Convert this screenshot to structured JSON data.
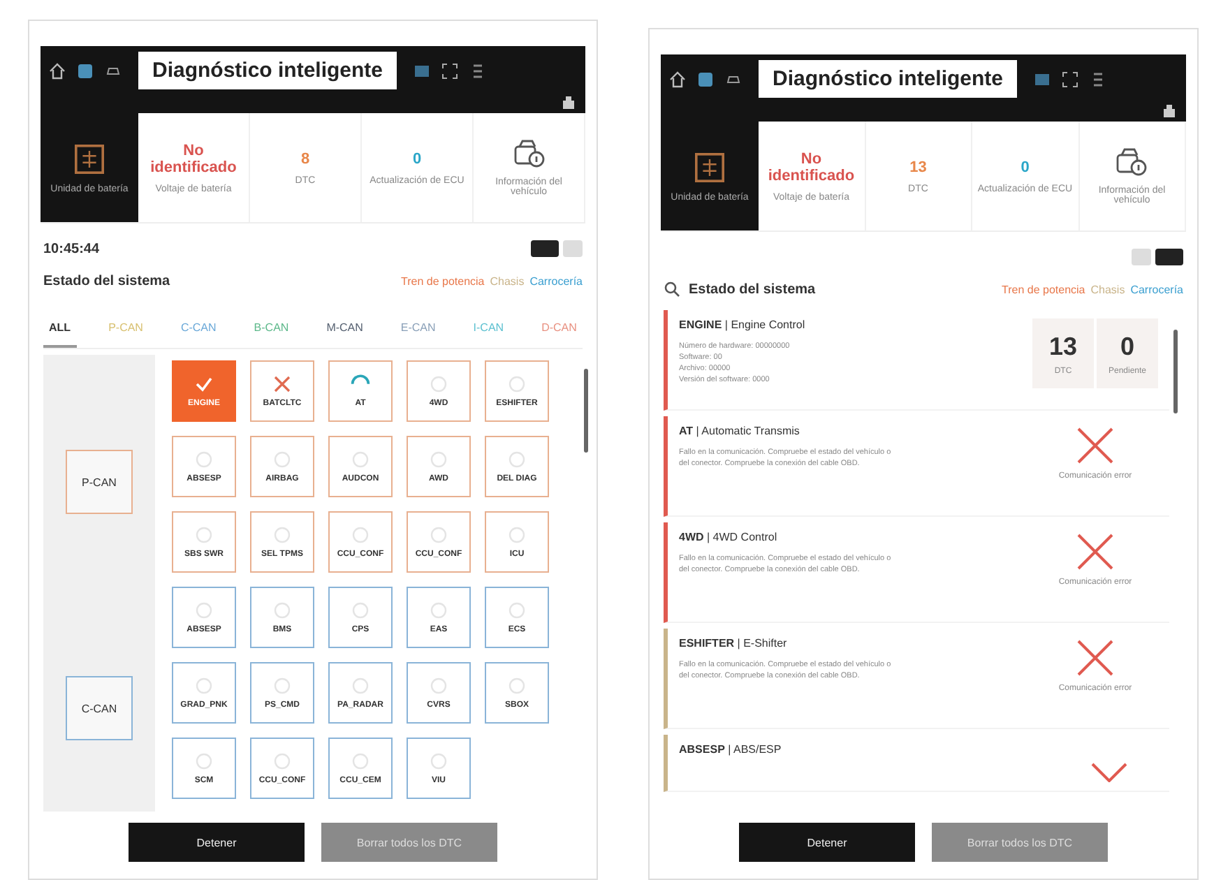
{
  "screens": [
    {
      "title": "Diagnóstico inteligente",
      "battery_label": "Unidad de batería",
      "stats": [
        {
          "kind": "text",
          "value": "No identificado",
          "label": "Voltaje de batería",
          "color": "#d9534f"
        },
        {
          "kind": "text",
          "value": "8",
          "label": "DTC",
          "color": "#e8874a"
        },
        {
          "kind": "text",
          "value": "0",
          "label": "Actualización de ECU",
          "color": "#2aa6c8"
        },
        {
          "kind": "icon",
          "label": "Información del vehículo"
        }
      ],
      "time": "10:45:44",
      "view_toggle": [
        {
          "selected": true
        },
        {
          "selected": false
        }
      ],
      "section_title": "Estado del sistema",
      "legend": [
        {
          "label": "Tren de potencia",
          "color": "#e8774a"
        },
        {
          "label": "Chasis",
          "color": "#c9b48a"
        },
        {
          "label": "Carrocería",
          "color": "#3b9fd0"
        }
      ],
      "tabs": [
        {
          "label": "ALL",
          "selected": true,
          "color": "#333333"
        },
        {
          "label": "P-CAN",
          "selected": false,
          "color": "#d8c070"
        },
        {
          "label": "C-CAN",
          "selected": false,
          "color": "#6aa8d8"
        },
        {
          "label": "B-CAN",
          "selected": false,
          "color": "#5cb88a"
        },
        {
          "label": "M-CAN",
          "selected": false,
          "color": "#556070"
        },
        {
          "label": "E-CAN",
          "selected": false,
          "color": "#8aa0b8"
        },
        {
          "label": "I-CAN",
          "selected": false,
          "color": "#5cc0d0"
        },
        {
          "label": "D-CAN",
          "selected": false,
          "color": "#e89080"
        }
      ],
      "groups": [
        {
          "bus": "P-CAN",
          "color": "#e8b090",
          "modules": [
            {
              "name": "ENGINE",
              "kind": "done",
              "selected": true
            },
            {
              "name": "BATCLTC",
              "kind": "failed",
              "selected": false
            },
            {
              "name": "AT",
              "kind": "scanning",
              "selected": false
            },
            {
              "name": "4WD",
              "kind": "pending",
              "selected": false
            },
            {
              "name": "ESHIFTER",
              "kind": "pending",
              "selected": false
            },
            {
              "name": "ABSESP",
              "kind": "pending",
              "selected": false
            },
            {
              "name": "AIRBAG",
              "kind": "pending",
              "selected": false
            },
            {
              "name": "AUDCON",
              "kind": "pending",
              "selected": false
            },
            {
              "name": "AWD",
              "kind": "pending",
              "selected": false
            },
            {
              "name": "DEL DIAG",
              "kind": "pending",
              "selected": false
            },
            {
              "name": "SBS SWR",
              "kind": "pending",
              "selected": false
            },
            {
              "name": "SEL TPMS",
              "kind": "pending",
              "selected": false
            },
            {
              "name": "CCU_CONF",
              "kind": "pending",
              "selected": false
            },
            {
              "name": "CCU_CONF",
              "kind": "pending",
              "selected": false
            },
            {
              "name": "ICU",
              "kind": "pending",
              "selected": false
            }
          ]
        },
        {
          "bus": "C-CAN",
          "color": "#8ab4d8",
          "modules": [
            {
              "name": "ABSESP",
              "kind": "pending",
              "selected": false
            },
            {
              "name": "BMS",
              "kind": "pending",
              "selected": false
            },
            {
              "name": "CPS",
              "kind": "pending",
              "selected": false
            },
            {
              "name": "EAS",
              "kind": "pending",
              "selected": false
            },
            {
              "name": "ECS",
              "kind": "pending",
              "selected": false
            },
            {
              "name": "GRAD_PNK",
              "kind": "pending",
              "selected": false
            },
            {
              "name": "PS_CMD",
              "kind": "pending",
              "selected": false
            },
            {
              "name": "PA_RADAR",
              "kind": "pending",
              "selected": false
            },
            {
              "name": "CVRS",
              "kind": "pending",
              "selected": false
            },
            {
              "name": "SBOX",
              "kind": "pending",
              "selected": false
            },
            {
              "name": "SCM",
              "kind": "pending",
              "selected": false
            },
            {
              "name": "CCU_CONF",
              "kind": "pending",
              "selected": false
            },
            {
              "name": "CCU_CEM",
              "kind": "pending",
              "selected": false
            },
            {
              "name": "VIU",
              "kind": "pending",
              "selected": false
            }
          ]
        }
      ],
      "buttons": [
        {
          "label": "Detener",
          "disabled": false
        },
        {
          "label": "Borrar todos los DTC",
          "disabled": true
        }
      ]
    },
    {
      "title": "Diagnóstico inteligente",
      "battery_label": "Unidad de batería",
      "stats": [
        {
          "kind": "text",
          "value": "No identificado",
          "label": "Voltaje de batería",
          "color": "#d9534f"
        },
        {
          "kind": "text",
          "value": "13",
          "label": "DTC",
          "color": "#e8874a"
        },
        {
          "kind": "text",
          "value": "0",
          "label": "Actualización de ECU",
          "color": "#2aa6c8"
        },
        {
          "kind": "icon",
          "label": "Información del vehículo"
        }
      ],
      "view_toggle": [
        {
          "selected": false
        },
        {
          "selected": true
        }
      ],
      "section_title": "Estado del sistema",
      "search": true,
      "legend": [
        {
          "label": "Tren de potencia",
          "color": "#e8774a"
        },
        {
          "label": "Chasis",
          "color": "#c9b48a"
        },
        {
          "label": "Carrocería",
          "color": "#3b9fd0"
        }
      ],
      "list": [
        {
          "kind": "counts",
          "title": "**ENGINE** | Engine Control",
          "color": "#e05a50",
          "details": [
            "Número de hardware: 00000000",
            "Software: 00",
            "Archivo: 00000",
            "Versión del software: 0000"
          ],
          "counts": [
            {
              "value": "13",
              "label": "DTC"
            },
            {
              "value": "0",
              "label": "Pendiente"
            }
          ]
        },
        {
          "kind": "error",
          "title": "**AT** | Automatic Transmis",
          "color": "#e05a50",
          "details": [
            "Fallo en la comunicación. Compruebe el estado del vehículo o",
            "del conector. Compruebe la conexión del cable OBD."
          ],
          "status": "Comunicación error"
        },
        {
          "kind": "error",
          "title": "**4WD** | 4WD Control",
          "color": "#e05a50",
          "details": [
            "Fallo en la comunicación. Compruebe el estado del vehículo o",
            "del conector. Compruebe la conexión del cable OBD."
          ],
          "status": "Comunicación error"
        },
        {
          "kind": "error",
          "title": "**ESHIFTER** | E-Shifter",
          "color": "#c9b48a",
          "details": [
            "Fallo en la comunicación. Compruebe el estado del vehículo o",
            "del conector. Compruebe la conexión del cable OBD."
          ],
          "status": "Comunicación error"
        },
        {
          "kind": "partial",
          "title": "**ABSESP** | ABS/ESP",
          "color": "#c9b48a"
        }
      ],
      "buttons": [
        {
          "label": "Detener",
          "disabled": false
        },
        {
          "label": "Borrar todos los DTC",
          "disabled": true
        }
      ]
    }
  ]
}
